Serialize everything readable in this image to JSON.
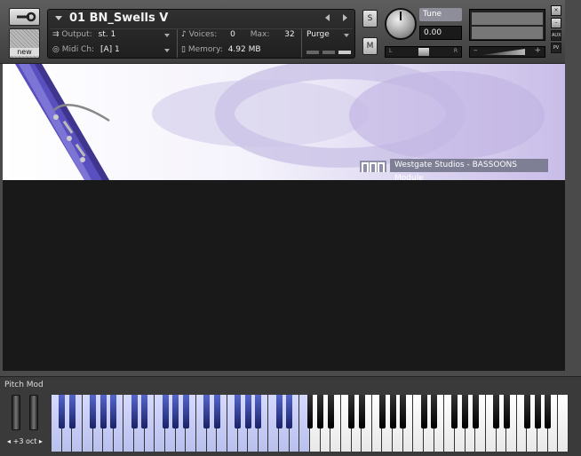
{
  "header": {
    "instrument_name": "01 BN_Swells V",
    "output_label": "Output:",
    "output_value": "st. 1",
    "voices_label": "Voices:",
    "voices_value": "0",
    "max_label": "Max:",
    "max_value": "32",
    "purge_label": "Purge",
    "midi_label": "Midi Ch:",
    "midi_value": "[A]  1",
    "memory_label": "Memory:",
    "memory_value": "4.92 MB",
    "new_label": "new",
    "solo_label": "S",
    "mute_label": "M",
    "tune_label": "Tune",
    "tune_value": "0.00",
    "pan_left": "L",
    "pan_right": "R",
    "vol_minus": "–",
    "vol_plus": "+",
    "close_label": "×",
    "minimize_label": "–",
    "aux_label": "AUX",
    "pv_label": "PV"
  },
  "banner": {
    "logo_text": "Westgate Studios - BASSOONS Module"
  },
  "keyboard": {
    "pitch_mod_label": "Pitch Mod",
    "octave_label": "+3 oct",
    "white_keys": 50,
    "blue_white_keys": 25,
    "colors": {
      "key_blue": "#b8c0ec",
      "black_key_blue": "#1a2266"
    }
  },
  "colors": {
    "banner_accent": "#c8bde8",
    "logo_bar": "#7e7e94",
    "body_bg": "#191919"
  }
}
